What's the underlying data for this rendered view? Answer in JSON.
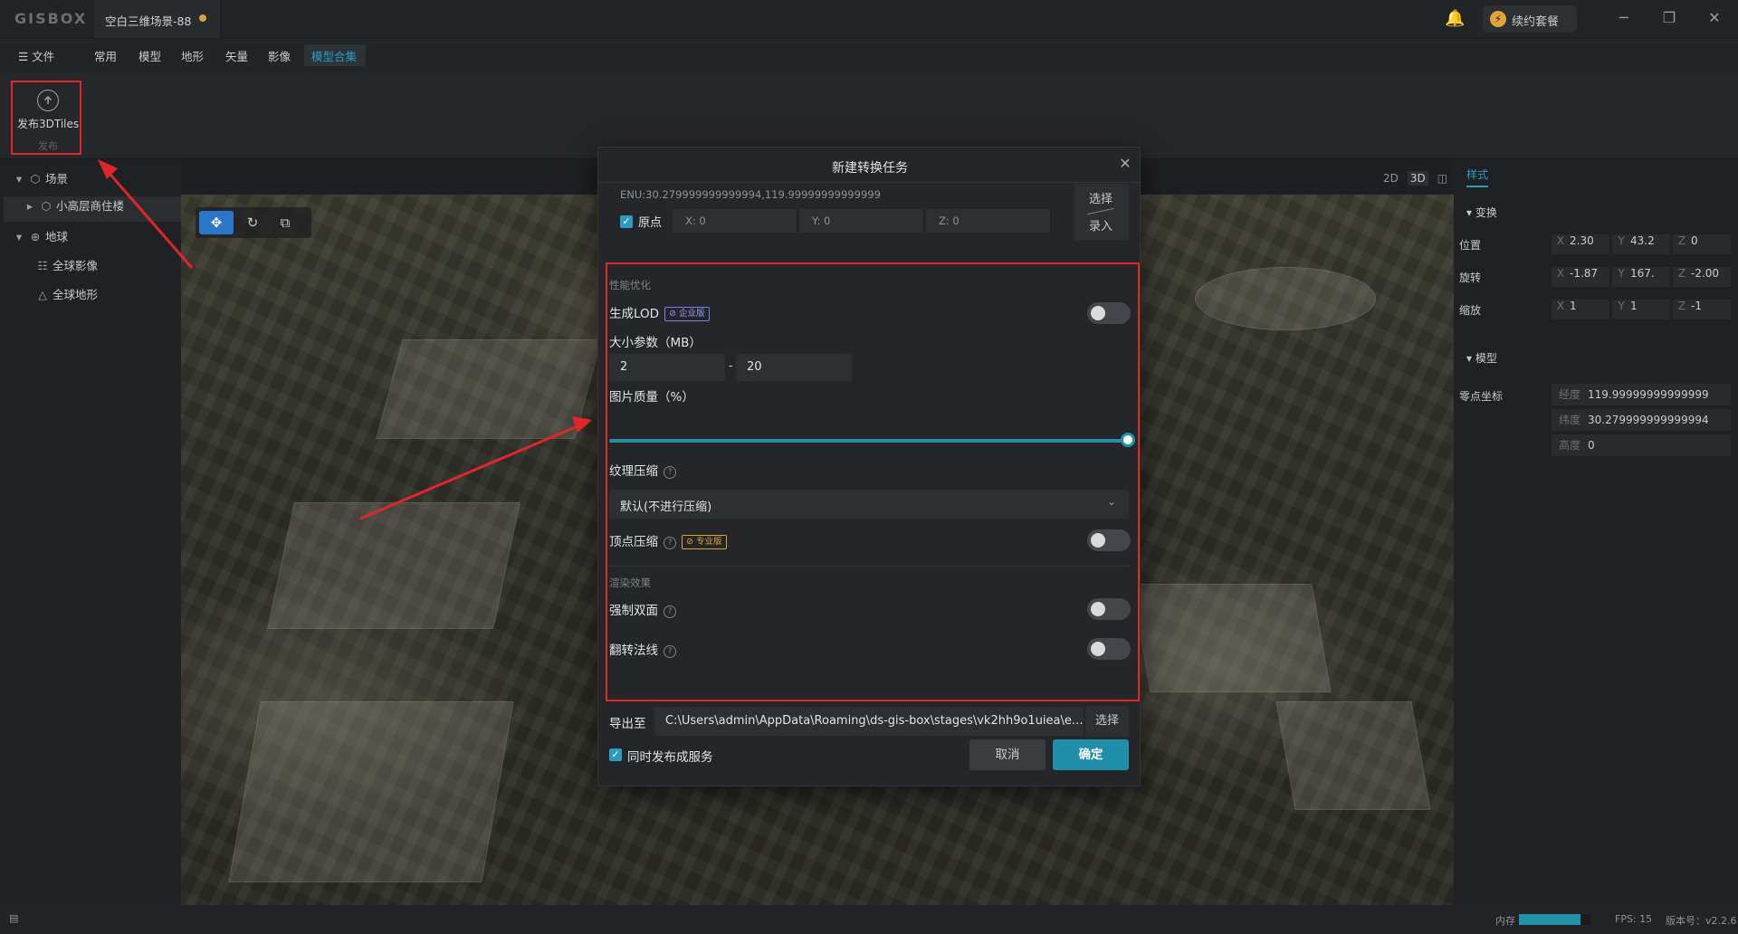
{
  "app": {
    "logo": "GISBOX",
    "doc_tab": "空白三维场景-88",
    "renew_label": "续约套餐"
  },
  "menu": {
    "file": "文件",
    "items": [
      "常用",
      "模型",
      "地形",
      "矢量",
      "影像",
      "模型合集"
    ],
    "active": "模型合集"
  },
  "ribbon": {
    "publish_label": "发布3DTiles",
    "group_label": "发布"
  },
  "tree": {
    "scene": "场景",
    "scene_child": "小高层商住楼",
    "globe": "地球",
    "globe_children": [
      "全球影像",
      "全球地形"
    ]
  },
  "view_modes": [
    "2D",
    "3D"
  ],
  "right_panel": {
    "tab": "样式",
    "transform_title": "变换",
    "position_label": "位置",
    "rotation_label": "旋转",
    "scale_label": "缩放",
    "position": {
      "x": "2.30",
      "y": "43.2",
      "z": "0"
    },
    "rotation": {
      "x": "-1.87",
      "y": "167.",
      "z": "-2.00"
    },
    "scale": {
      "x": "1",
      "y": "1",
      "z": "-1"
    },
    "model_title": "模型",
    "anchor_label": "零点坐标",
    "anchor": {
      "lon_label": "经度",
      "lon": "119.99999999999999",
      "lat_label": "纬度",
      "lat": "30.279999999999994",
      "height_label": "高度",
      "height": "0"
    }
  },
  "dialog": {
    "title": "新建转换任务",
    "enu": "ENU:30.279999999999994,119.99999999999999",
    "origin_label": "原点",
    "origin": {
      "x": "X: 0",
      "y": "Y: 0",
      "z": "Z: 0"
    },
    "pick_label": "选择",
    "input_label": "录入",
    "perf_title": "性能优化",
    "lod_label": "生成LOD",
    "lod_tag": "企业版",
    "size_label": "大小参数（MB）",
    "size_min": "2",
    "size_sep": "-",
    "size_max": "20",
    "quality_label": "图片质量（%）",
    "quality_value": 100,
    "texture_label": "纹理压缩",
    "texture_select": "默认(不进行压缩)",
    "vertex_label": "顶点压缩",
    "vertex_tag": "专业版",
    "render_title": "渲染效果",
    "double_side_label": "强制双面",
    "flip_normal_label": "翻转法线",
    "export_label": "导出至",
    "export_path": "C:\\Users\\admin\\AppData\\Roaming\\ds-gis-box\\stages\\vk2hh9o1uiea\\exp…",
    "export_pick": "选择",
    "publish_service_label": "同时发布成服务",
    "cancel": "取消",
    "confirm": "确定",
    "toggles": {
      "lod": false,
      "vertex": false,
      "double_side": false,
      "flip_normal": false
    },
    "publish_service_checked": true,
    "origin_checked": true
  },
  "status": {
    "memory_label": "内存",
    "memory_fraction": 0.85,
    "fps": "FPS: 15",
    "version": "版本号：v2.2.6"
  },
  "colors": {
    "accent": "#2292a8",
    "highlight": "#e0262b",
    "enterprise_tag": "#7b7ef0",
    "pro_tag": "#d6a33b"
  }
}
